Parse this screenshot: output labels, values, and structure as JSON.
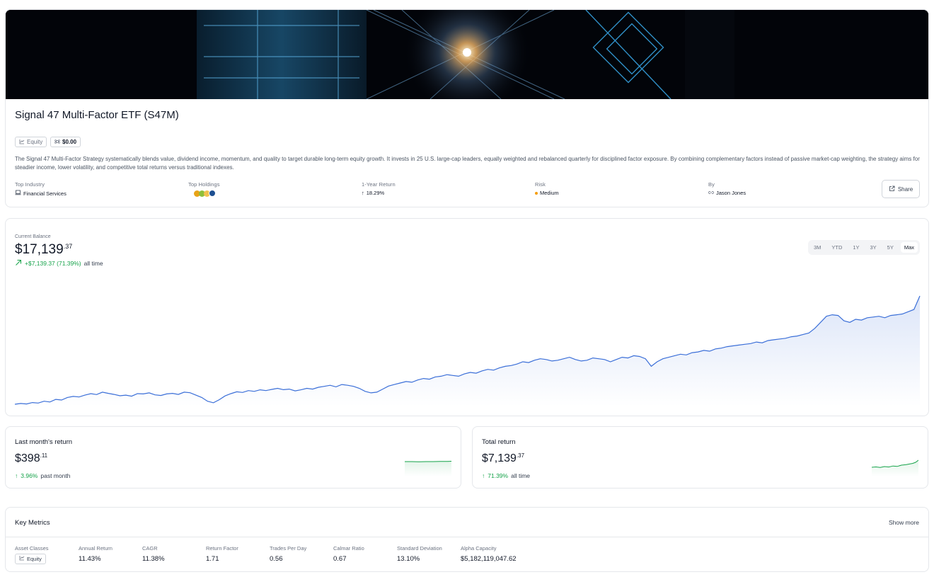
{
  "fund": {
    "title": "Signal 47 Multi-Factor ETF (S47M)",
    "asset_chip": "Equity",
    "price_chip": "$0.00",
    "description": "The Signal 47 Multi-Factor Strategy systematically blends value, dividend income, momentum, and quality to target durable long-term equity growth. It invests in 25 U.S. large-cap leaders, equally weighted and rebalanced quarterly for disciplined factor exposure. By combining complementary factors instead of passive market-cap weighting, the strategy aims for steadier income, lower volatility, and competitive total returns versus traditional indexes."
  },
  "stats": {
    "top_industry_label": "Top Industry",
    "top_industry_value": "Financial Services",
    "top_holdings_label": "Top Holdings",
    "one_year_label": "1-Year Return",
    "one_year_value": "18.29%",
    "risk_label": "Risk",
    "risk_value": "Medium",
    "by_label": "By",
    "by_value": "Jason Jones"
  },
  "share_label": "Share",
  "balance": {
    "label": "Current Balance",
    "whole": "$17,139",
    "cents": ".37",
    "change": "+$7,139.37 (71.39%)",
    "change_suffix": "all time"
  },
  "range_tabs": [
    "3M",
    "YTD",
    "1Y",
    "3Y",
    "5Y",
    "Max"
  ],
  "active_range": "Max",
  "last_month": {
    "title": "Last month's return",
    "whole": "$398",
    "cents": ".11",
    "change": "3.96%",
    "suffix": "past month"
  },
  "total_return": {
    "title": "Total return",
    "whole": "$7,139",
    "cents": ".37",
    "change": "71.39%",
    "suffix": "all time"
  },
  "metrics": {
    "title": "Key Metrics",
    "show_more": "Show more",
    "asset_classes_label": "Asset Classes",
    "asset_classes_value": "Equity",
    "items": [
      {
        "label": "Annual Return",
        "value": "11.43%"
      },
      {
        "label": "CAGR",
        "value": "11.38%"
      },
      {
        "label": "Return Factor",
        "value": "1.71"
      },
      {
        "label": "Trades Per Day",
        "value": "0.56"
      },
      {
        "label": "Calmar Ratio",
        "value": "0.67"
      },
      {
        "label": "Standard Deviation",
        "value": "13.10%"
      },
      {
        "label": "Alpha Capacity",
        "value": "$5,182,119,047.62"
      }
    ]
  },
  "colors": {
    "accent_line": "#3b6fd8",
    "positive": "#16a34a",
    "risk_medium": "#f59e0b"
  },
  "chart_data": {
    "type": "area",
    "title": "",
    "xlabel": "",
    "ylabel": "",
    "grid": false,
    "series": [
      {
        "values": [
          10000,
          10050,
          10020,
          10110,
          10080,
          10200,
          10150,
          10320,
          10280,
          10450,
          10520,
          10480,
          10600,
          10700,
          10640,
          10800,
          10720,
          10650,
          10560,
          10600,
          10530,
          10700,
          10680,
          10750,
          10620,
          10580,
          10680,
          10720,
          10650,
          10800,
          10760,
          10600,
          10450,
          10200,
          10100,
          10300,
          10550,
          10700,
          10820,
          10780,
          10900,
          10850,
          10950,
          10900,
          10980,
          11050,
          10960,
          11000,
          10880,
          10950,
          11050,
          11000,
          11120,
          11180,
          11250,
          11150,
          11300,
          11250,
          11180,
          11050,
          10850,
          10750,
          10800,
          11000,
          11200,
          11300,
          11400,
          11500,
          11450,
          11600,
          11700,
          11650,
          11800,
          11850,
          11950,
          11900,
          11850,
          12000,
          12100,
          12050,
          12200,
          12300,
          12250,
          12400,
          12500,
          12550,
          12650,
          12800,
          12750,
          12900,
          13000,
          12950,
          12850,
          12900,
          13000,
          13100,
          12950,
          12850,
          12900,
          13050,
          13000,
          12950,
          12800,
          12950,
          13100,
          13050,
          13200,
          13150,
          13000,
          12500,
          12800,
          13000,
          13100,
          13200,
          13300,
          13250,
          13400,
          13450,
          13550,
          13500,
          13650,
          13700,
          13800,
          13850,
          13900,
          13950,
          14000,
          14100,
          14050,
          14200,
          14250,
          14300,
          14350,
          14450,
          14500,
          14600,
          14700,
          15000,
          15400,
          15800,
          15900,
          15850,
          15500,
          15400,
          15600,
          15550,
          15700,
          15750,
          15800,
          15700,
          15850,
          15900,
          15950,
          16100,
          16250,
          17139
        ]
      }
    ]
  }
}
